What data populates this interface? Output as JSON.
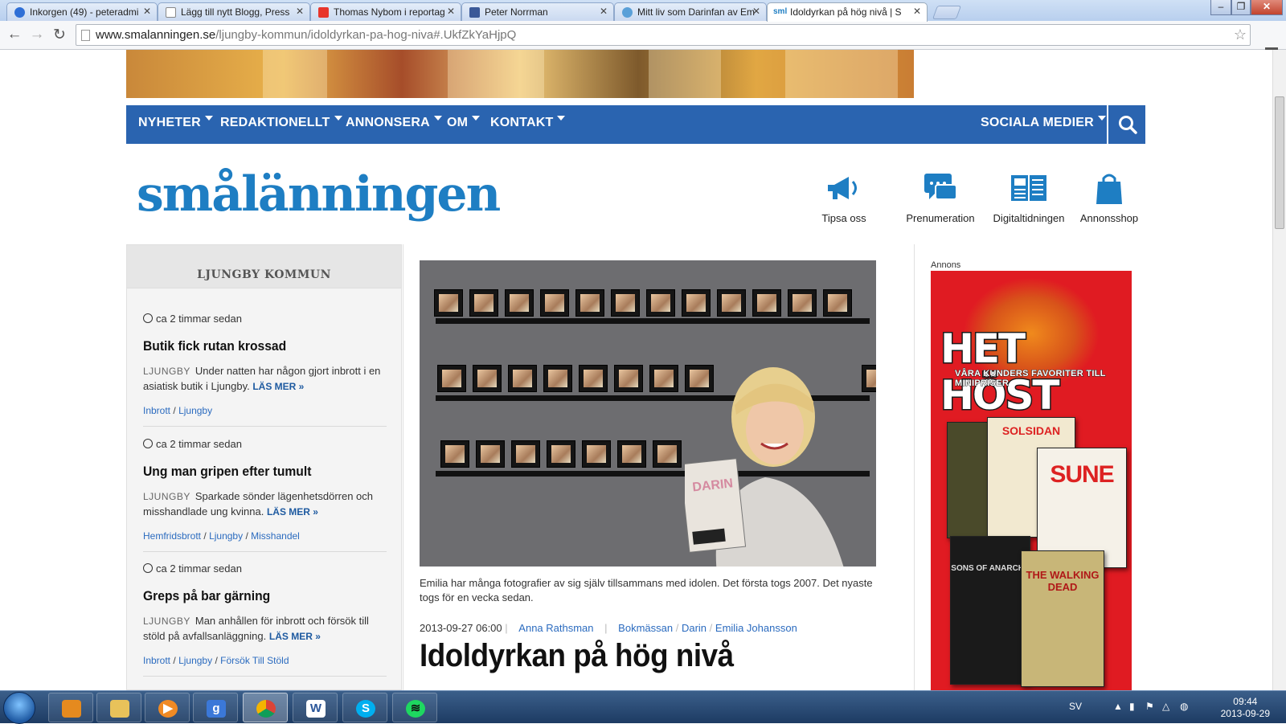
{
  "browser": {
    "tabs": [
      {
        "title": "Inkorgen (49) - peteradmi",
        "icon_color": "#2f6fd6"
      },
      {
        "title": "Lägg till nytt Blogg, Press",
        "icon_color": "#ffffff"
      },
      {
        "title": "Thomas Nybom i reportag",
        "icon_color": "#e8352b"
      },
      {
        "title": "Peter Norrman",
        "icon_color": "#3b5998"
      },
      {
        "title": "Mitt liv som Darinfan av Em",
        "icon_color": "#5aa0d8"
      },
      {
        "title": "Idoldyrkan på hög nivå | S",
        "icon_color": "#1e7ec3",
        "icon_text": "sml"
      }
    ],
    "url_host": "www.smalanningen.se",
    "url_path": "/ljungby-kommun/idoldyrkan-pa-hog-niva#.UkfZkYaHjpQ"
  },
  "nav": {
    "items": [
      "NYHETER",
      "REDAKTIONELLT",
      "ANNONSERA",
      "OM",
      "KONTAKT"
    ],
    "social": "SOCIALA MEDIER"
  },
  "logo": "smålänningen",
  "services": [
    "Tipsa oss",
    "Prenumeration",
    "Digitaltidningen",
    "Annonsshop"
  ],
  "sidebar": {
    "heading": "LJUNGBY KOMMUN",
    "news": [
      {
        "time": "ca 2 timmar sedan",
        "title": "Butik fick rutan krossad",
        "location": "LJUNGBY",
        "text": "Under natten har någon gjort inbrott i en asiatisk butik i Ljungby.",
        "more": "LÄS MER »",
        "tags": [
          "Inbrott",
          "Ljungby"
        ]
      },
      {
        "time": "ca 2 timmar sedan",
        "title": "Ung man gripen efter tumult",
        "location": "LJUNGBY",
        "text": "Sparkade sönder lägenhetsdörren och misshandlade ung kvinna.",
        "more": "LÄS MER »",
        "tags": [
          "Hemfridsbrott",
          "Ljungby",
          "Misshandel"
        ]
      },
      {
        "time": "ca 2 timmar sedan",
        "title": "Greps på bar gärning",
        "location": "LJUNGBY",
        "text": "Man anhållen för inbrott och försök till stöld på avfallsanläggning.",
        "more": "LÄS MER »",
        "tags": [
          "Inbrott",
          "Ljungby",
          "Försök Till Stöld"
        ]
      }
    ]
  },
  "article": {
    "caption": "Emilia har många fotografier av sig själv tillsammans med idolen. Det första togs 2007. Det nyaste togs för en vecka sedan.",
    "date": "2013-09-27 06:00",
    "author": "Anna Rathsman",
    "tags": [
      "Bokmässan",
      "Darin",
      "Emilia Johansson"
    ],
    "headline": "Idoldyrkan på hög nivå",
    "book_text": "DARIN"
  },
  "ad": {
    "label": "Annons",
    "headline": "HET HÖST",
    "subline": "VÅRA KUNDERS FAVORITER TILL MINIPRISER",
    "titles": [
      "SOLSIDAN",
      "SUNE",
      "SONS OF ANARCHY",
      "THE WALKING DEAD"
    ]
  },
  "taskbar": {
    "lang": "SV",
    "time": "09:44",
    "date": "2013-09-29"
  },
  "colors": {
    "nav_blue": "#2a64b0",
    "logo_blue": "#1e7ec3",
    "link_blue": "#2b6bbf",
    "ad_red": "#e01b22"
  }
}
